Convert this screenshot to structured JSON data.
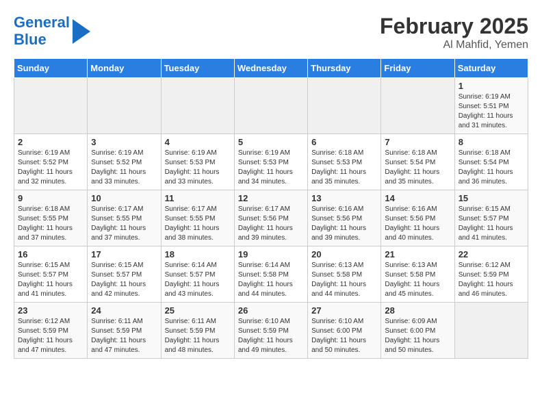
{
  "logo": {
    "line1": "General",
    "line2": "Blue"
  },
  "title": "February 2025",
  "location": "Al Mahfid, Yemen",
  "days_of_week": [
    "Sunday",
    "Monday",
    "Tuesday",
    "Wednesday",
    "Thursday",
    "Friday",
    "Saturday"
  ],
  "weeks": [
    [
      {
        "day": "",
        "content": ""
      },
      {
        "day": "",
        "content": ""
      },
      {
        "day": "",
        "content": ""
      },
      {
        "day": "",
        "content": ""
      },
      {
        "day": "",
        "content": ""
      },
      {
        "day": "",
        "content": ""
      },
      {
        "day": "1",
        "content": "Sunrise: 6:19 AM\nSunset: 5:51 PM\nDaylight: 11 hours and 31 minutes."
      }
    ],
    [
      {
        "day": "2",
        "content": "Sunrise: 6:19 AM\nSunset: 5:52 PM\nDaylight: 11 hours and 32 minutes."
      },
      {
        "day": "3",
        "content": "Sunrise: 6:19 AM\nSunset: 5:52 PM\nDaylight: 11 hours and 33 minutes."
      },
      {
        "day": "4",
        "content": "Sunrise: 6:19 AM\nSunset: 5:53 PM\nDaylight: 11 hours and 33 minutes."
      },
      {
        "day": "5",
        "content": "Sunrise: 6:19 AM\nSunset: 5:53 PM\nDaylight: 11 hours and 34 minutes."
      },
      {
        "day": "6",
        "content": "Sunrise: 6:18 AM\nSunset: 5:53 PM\nDaylight: 11 hours and 35 minutes."
      },
      {
        "day": "7",
        "content": "Sunrise: 6:18 AM\nSunset: 5:54 PM\nDaylight: 11 hours and 35 minutes."
      },
      {
        "day": "8",
        "content": "Sunrise: 6:18 AM\nSunset: 5:54 PM\nDaylight: 11 hours and 36 minutes."
      }
    ],
    [
      {
        "day": "9",
        "content": "Sunrise: 6:18 AM\nSunset: 5:55 PM\nDaylight: 11 hours and 37 minutes."
      },
      {
        "day": "10",
        "content": "Sunrise: 6:17 AM\nSunset: 5:55 PM\nDaylight: 11 hours and 37 minutes."
      },
      {
        "day": "11",
        "content": "Sunrise: 6:17 AM\nSunset: 5:55 PM\nDaylight: 11 hours and 38 minutes."
      },
      {
        "day": "12",
        "content": "Sunrise: 6:17 AM\nSunset: 5:56 PM\nDaylight: 11 hours and 39 minutes."
      },
      {
        "day": "13",
        "content": "Sunrise: 6:16 AM\nSunset: 5:56 PM\nDaylight: 11 hours and 39 minutes."
      },
      {
        "day": "14",
        "content": "Sunrise: 6:16 AM\nSunset: 5:56 PM\nDaylight: 11 hours and 40 minutes."
      },
      {
        "day": "15",
        "content": "Sunrise: 6:15 AM\nSunset: 5:57 PM\nDaylight: 11 hours and 41 minutes."
      }
    ],
    [
      {
        "day": "16",
        "content": "Sunrise: 6:15 AM\nSunset: 5:57 PM\nDaylight: 11 hours and 41 minutes."
      },
      {
        "day": "17",
        "content": "Sunrise: 6:15 AM\nSunset: 5:57 PM\nDaylight: 11 hours and 42 minutes."
      },
      {
        "day": "18",
        "content": "Sunrise: 6:14 AM\nSunset: 5:57 PM\nDaylight: 11 hours and 43 minutes."
      },
      {
        "day": "19",
        "content": "Sunrise: 6:14 AM\nSunset: 5:58 PM\nDaylight: 11 hours and 44 minutes."
      },
      {
        "day": "20",
        "content": "Sunrise: 6:13 AM\nSunset: 5:58 PM\nDaylight: 11 hours and 44 minutes."
      },
      {
        "day": "21",
        "content": "Sunrise: 6:13 AM\nSunset: 5:58 PM\nDaylight: 11 hours and 45 minutes."
      },
      {
        "day": "22",
        "content": "Sunrise: 6:12 AM\nSunset: 5:59 PM\nDaylight: 11 hours and 46 minutes."
      }
    ],
    [
      {
        "day": "23",
        "content": "Sunrise: 6:12 AM\nSunset: 5:59 PM\nDaylight: 11 hours and 47 minutes."
      },
      {
        "day": "24",
        "content": "Sunrise: 6:11 AM\nSunset: 5:59 PM\nDaylight: 11 hours and 47 minutes."
      },
      {
        "day": "25",
        "content": "Sunrise: 6:11 AM\nSunset: 5:59 PM\nDaylight: 11 hours and 48 minutes."
      },
      {
        "day": "26",
        "content": "Sunrise: 6:10 AM\nSunset: 5:59 PM\nDaylight: 11 hours and 49 minutes."
      },
      {
        "day": "27",
        "content": "Sunrise: 6:10 AM\nSunset: 6:00 PM\nDaylight: 11 hours and 50 minutes."
      },
      {
        "day": "28",
        "content": "Sunrise: 6:09 AM\nSunset: 6:00 PM\nDaylight: 11 hours and 50 minutes."
      },
      {
        "day": "",
        "content": ""
      }
    ]
  ]
}
